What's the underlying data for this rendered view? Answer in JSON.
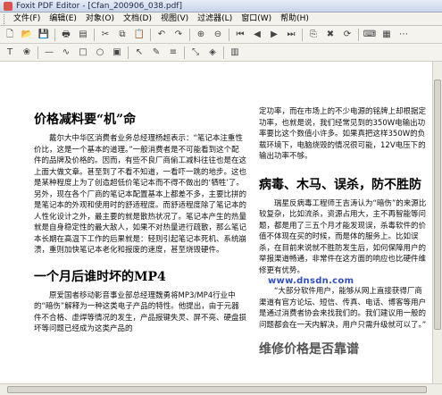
{
  "window": {
    "title": "Foxit PDF Editor - [Cfan_200906_038.pdf]"
  },
  "menu": [
    {
      "label": "文件(F)"
    },
    {
      "label": "编辑(E)"
    },
    {
      "label": "对象(O)"
    },
    {
      "label": "文档(D)"
    },
    {
      "label": "视图(V)"
    },
    {
      "label": "过滤器(L)"
    },
    {
      "label": "窗口(W)"
    },
    {
      "label": "帮助(H)"
    }
  ],
  "toolbar1": [
    {
      "name": "new-icon",
      "glyph": "🗋"
    },
    {
      "name": "open-icon",
      "glyph": "📂"
    },
    {
      "name": "save-icon",
      "glyph": "💾"
    },
    {
      "name": "print-icon",
      "glyph": "🖶"
    },
    {
      "name": "properties-icon",
      "glyph": "▤"
    },
    {
      "name": "cut-icon",
      "glyph": "✂"
    },
    {
      "name": "copy-icon",
      "glyph": "⧉"
    },
    {
      "name": "paste-icon",
      "glyph": "📋"
    },
    {
      "name": "undo-icon",
      "glyph": "↶"
    },
    {
      "name": "redo-icon",
      "glyph": "↷"
    },
    {
      "name": "zoom-in-icon",
      "glyph": "⊕"
    },
    {
      "name": "zoom-out-icon",
      "glyph": "⊖"
    },
    {
      "name": "first-page-icon",
      "glyph": "⏮"
    },
    {
      "name": "prev-page-icon",
      "glyph": "◀"
    },
    {
      "name": "next-page-icon",
      "glyph": "▶"
    },
    {
      "name": "last-page-icon",
      "glyph": "⏭"
    },
    {
      "name": "insert-page-icon",
      "glyph": "⎘"
    },
    {
      "name": "delete-page-icon",
      "glyph": "✖"
    },
    {
      "name": "rotate-icon",
      "glyph": "⟳"
    },
    {
      "name": "keyboard-icon",
      "glyph": "⌨"
    },
    {
      "name": "grid-icon",
      "glyph": "▦"
    },
    {
      "name": "dots-icon",
      "glyph": "⋯"
    }
  ],
  "toolbar2": [
    {
      "name": "text-tool-icon",
      "glyph": "T"
    },
    {
      "name": "color-text-icon",
      "glyph": "❀"
    },
    {
      "name": "line-tool-icon",
      "glyph": "—"
    },
    {
      "name": "curve-tool-icon",
      "glyph": "∿"
    },
    {
      "name": "rect-tool-icon",
      "glyph": "□"
    },
    {
      "name": "ellipse-tool-icon",
      "glyph": "○"
    },
    {
      "name": "image-tool-icon",
      "glyph": "▣"
    },
    {
      "name": "select-tool-icon",
      "glyph": "↖"
    },
    {
      "name": "edit-object-icon",
      "glyph": "✎"
    },
    {
      "name": "align-icon",
      "glyph": "≡"
    },
    {
      "name": "transform-icon",
      "glyph": "⤡"
    },
    {
      "name": "fill-color-icon",
      "glyph": "◈"
    },
    {
      "name": "layer-icon",
      "glyph": "▥"
    }
  ],
  "document": {
    "left": {
      "h1": "价格减料要“机”命",
      "p1": "戴尔大中华区消费者业务总经理杨超表示：“笔记本注重性价比，这是一个基本的道理。”一般消费者是不可能看到这个配件的品牌及价格的。因而，有些不良厂商偷工减料往往也是在这上面大做文章。甚至到了不看不知道，一看吓一跳的地步。这也是某种程度上为了创造超低价笔记本而不得不做出的‘牺牲’了。另外，现在各个厂商的笔记本配置基本上都差不多，主要比拼的是笔记本的外观和使用时的舒适程度。而舒适程度除了笔记本的人性化设计之外，最主要的就是散热状况了。笔记本产生的热量就是自身稳定性的最大敌人，如果不对热量进行疏散，那么笔记本长期在高温下工作的后果就是：轻则引起笔记本死机、系统崩溃，重则加快笔记本老化和报废的速度，甚至烧毁硬件。",
      "h2": "一个月后谁时坏的MP4",
      "p2": "原爱国者移动影音事业部总经理魏勇将MP3/MP4行业中的“暗伤”解释为一种这类电子产品的特性。他提出，由于元器件不合格、虚焊等情况的发生，产品报键失灵、屏不亮、硬盘损坏等问题已经成为这类产品的"
    },
    "right": {
      "p0": "定功率，而在市场上的不少电源的铭牌上却根据定功率，也就是说，我们经常见到的350W电输出功率要比这个数值小许多。如果真把这样350W的负载环境下，电脑烧毁的情况很可能，12V电压下的输出功率不够。",
      "h1": "病毒、木马、误杀，防不胜防",
      "p1": "瑞星反病毒工程师王吉涛认为“暗伤”的来源比较复杂，比如流杀，资源占用大，主不再智能等问题，都是用了三五个月才能发现误，杀毒软件的价值不体现在买的时候，而是体的服务上。比如误杀，在目前来说就不胜防发生后，如何保障用户的举报渠道畅通，非常件在这方面的响应也比硬件维修更有优势。",
      "watermark": "www.dnsdn.com",
      "p2": "“大部分软件用户，能够从网上直接获得厂商渠道有官方论坛、短信、传真、电话、博客等用户是通过消费者协会来找我们的。我们建议用一般的问题都会在一天内解决，用户只需升级就可以了。”",
      "h2": "维修价格是否靠谱"
    }
  }
}
